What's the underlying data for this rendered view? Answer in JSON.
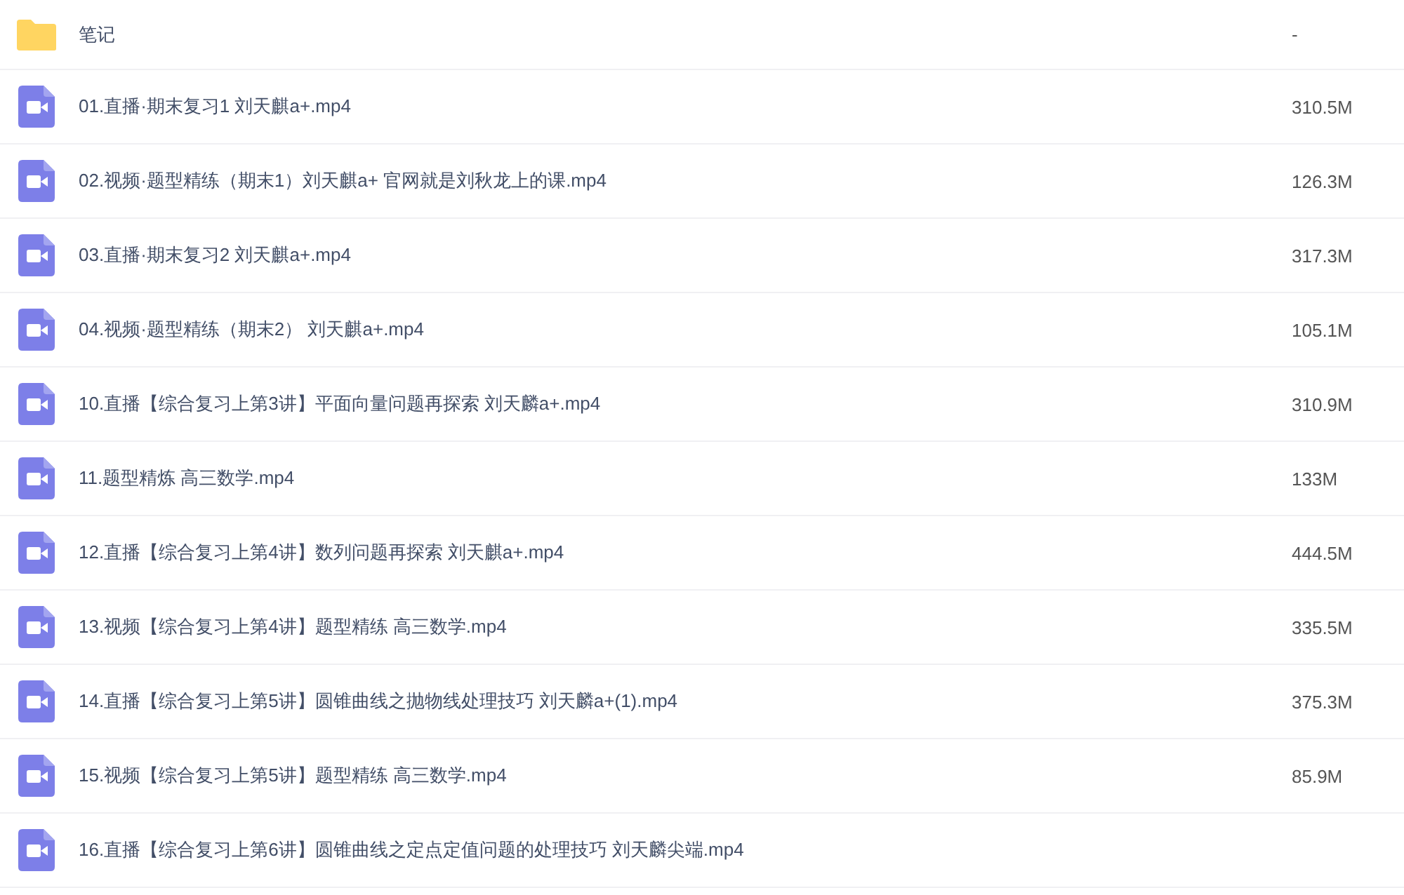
{
  "files": [
    {
      "kind": "folder",
      "name": "笔记",
      "size": "-"
    },
    {
      "kind": "video",
      "name": "01.直播·期末复习1 刘天麒a+.mp4",
      "size": "310.5M"
    },
    {
      "kind": "video",
      "name": "02.视频·题型精练（期末1）刘天麒a+ 官网就是刘秋龙上的课.mp4",
      "size": "126.3M"
    },
    {
      "kind": "video",
      "name": "03.直播·期末复习2 刘天麒a+.mp4",
      "size": "317.3M"
    },
    {
      "kind": "video",
      "name": "04.视频·题型精练（期末2） 刘天麒a+.mp4",
      "size": "105.1M"
    },
    {
      "kind": "video",
      "name": "10.直播【综合复习上第3讲】平面向量问题再探索 刘天麟a+.mp4",
      "size": "310.9M"
    },
    {
      "kind": "video",
      "name": "11.题型精炼 高三数学.mp4",
      "size": "133M"
    },
    {
      "kind": "video",
      "name": "12.直播【综合复习上第4讲】数列问题再探索 刘天麒a+.mp4",
      "size": "444.5M"
    },
    {
      "kind": "video",
      "name": "13.视频【综合复习上第4讲】题型精练 高三数学.mp4",
      "size": "335.5M"
    },
    {
      "kind": "video",
      "name": "14.直播【综合复习上第5讲】圆锥曲线之抛物线处理技巧 刘天麟a+(1).mp4",
      "size": "375.3M"
    },
    {
      "kind": "video",
      "name": "15.视频【综合复习上第5讲】题型精练 高三数学.mp4",
      "size": "85.9M"
    },
    {
      "kind": "video",
      "name": "16.直播【综合复习上第6讲】圆锥曲线之定点定值问题的处理技巧 刘天麟尖端.mp4"
    }
  ]
}
